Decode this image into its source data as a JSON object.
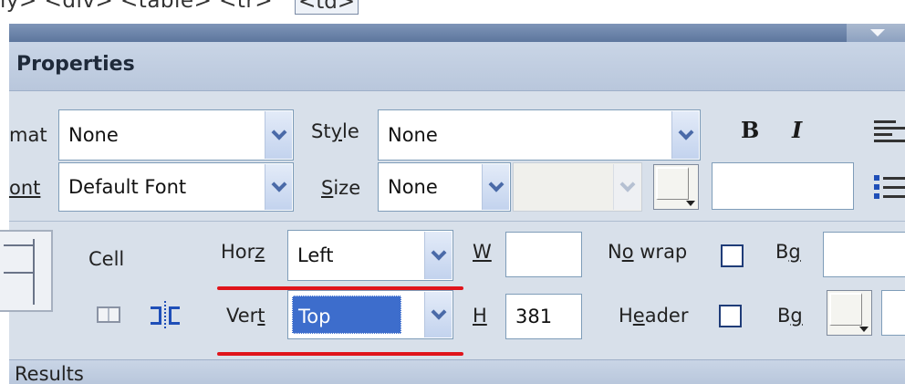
{
  "tag_selector": {
    "path": "ly> <div> <table> <tr> ",
    "current": "<td>"
  },
  "panel": {
    "title": "Properties",
    "format": {
      "label": "mat",
      "value": "None"
    },
    "style": {
      "label_pre": "St",
      "label_u": "y",
      "label_post": "le",
      "value": "None"
    },
    "bold_label": "B",
    "italic_label": "I",
    "font": {
      "label": "ont",
      "value": "Default Font"
    },
    "size": {
      "label_u": "S",
      "label_post": "ize",
      "value": "None"
    },
    "cell_label": "Cell",
    "horz": {
      "label_pre": "Hor",
      "label_u": "z",
      "value": "Left"
    },
    "vert": {
      "label_pre": "Ver",
      "label_u": "t",
      "value": "Top"
    },
    "width": {
      "label_u": "W",
      "value": ""
    },
    "height": {
      "label_u": "H",
      "value": "381"
    },
    "nowrap": {
      "label_pre": "N",
      "label_u": "o",
      "label_post": " wrap",
      "checked": false
    },
    "header": {
      "label_pre": "H",
      "label_u": "e",
      "label_post": "ader",
      "checked": false
    },
    "bg1": {
      "label_pre": "B",
      "label_u": "g"
    },
    "bg2": {
      "label_pre": "B",
      "label_u": "g"
    }
  },
  "results_label": "Results",
  "colors": {
    "selection": "#3d6dcc",
    "highlight_lines": "#e0141b",
    "panel_bg": "#d8e0ea",
    "field_border": "#7f9db9"
  }
}
